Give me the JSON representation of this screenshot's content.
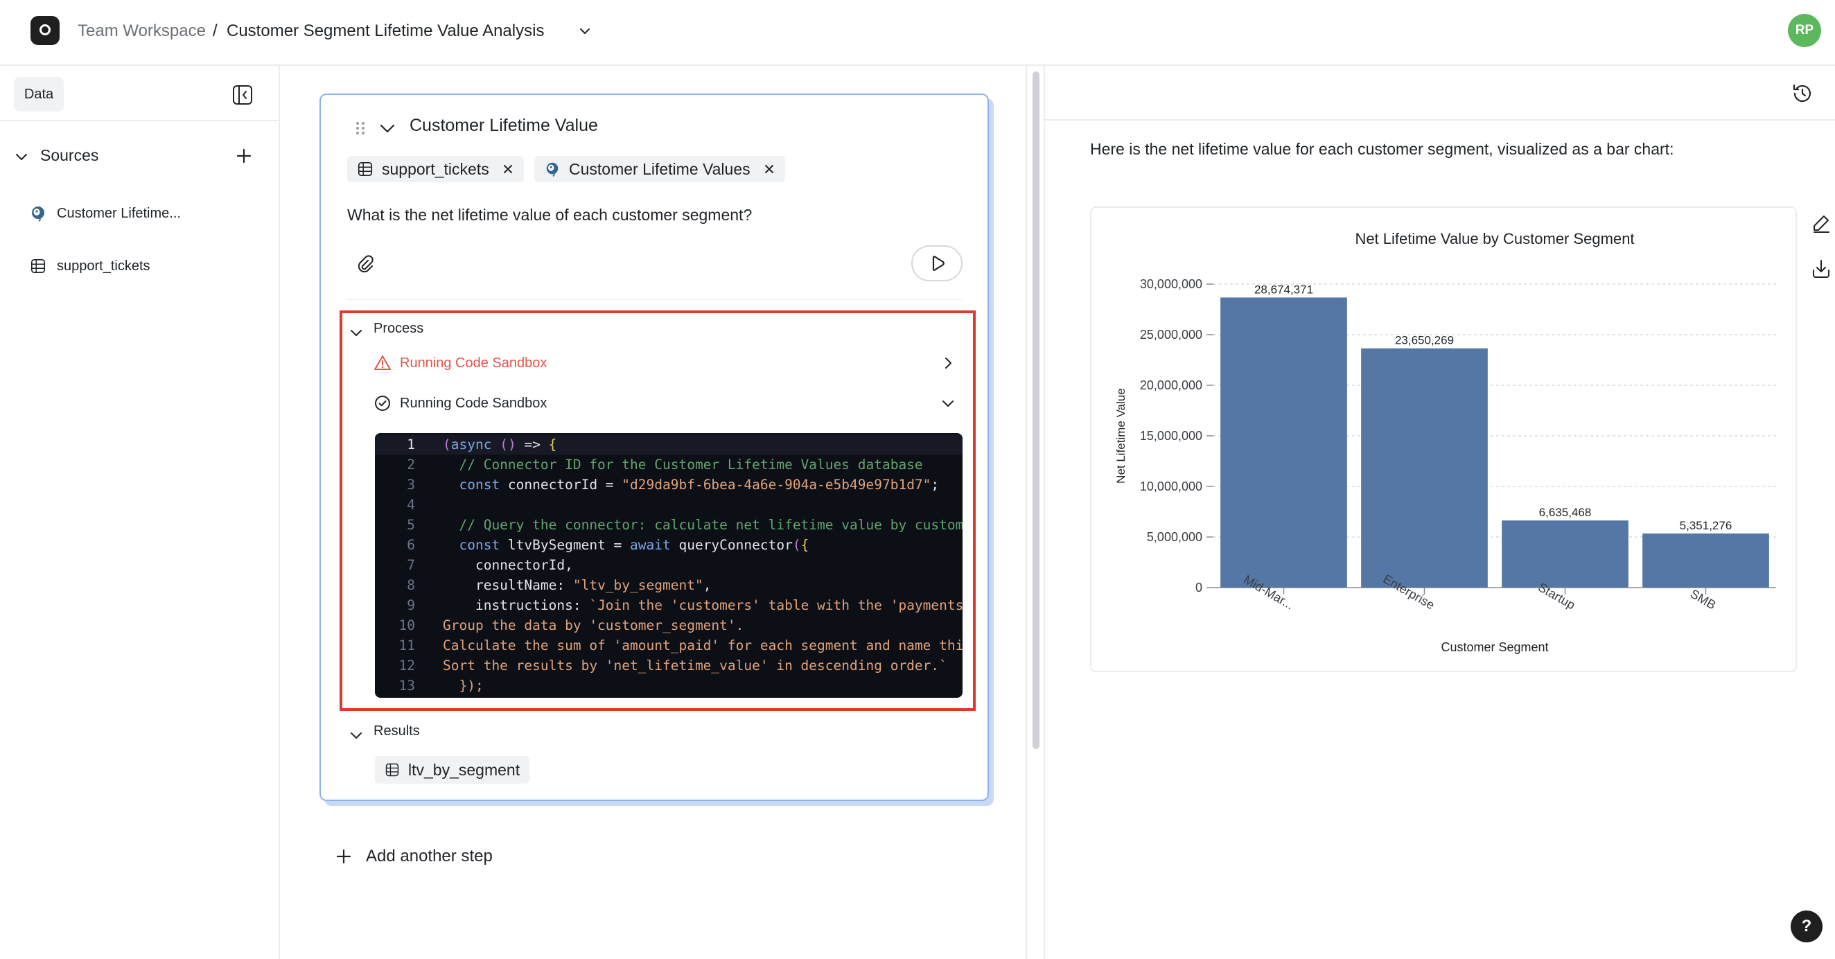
{
  "header": {
    "workspace": "Team Workspace",
    "separator": "/",
    "title": "Customer Segment Lifetime Value Analysis",
    "avatar_initials": "RP",
    "avatar_color": "#5cb85c"
  },
  "sidebar": {
    "tab_label": "Data",
    "sources_label": "Sources",
    "items": [
      {
        "label": "Customer Lifetime...",
        "icon": "postgres-elephant-icon"
      },
      {
        "label": "support_tickets",
        "icon": "table-icon"
      }
    ]
  },
  "step": {
    "title": "Customer Lifetime Value",
    "chips": [
      {
        "label": "support_tickets",
        "icon": "table-icon"
      },
      {
        "label": "Customer Lifetime Values",
        "icon": "postgres-elephant-icon"
      }
    ],
    "question": "What is the net lifetime value of each customer segment?",
    "process_label": "Process",
    "process_steps": [
      {
        "label": "Running Code Sandbox",
        "status": "error",
        "color": "#e5534b"
      },
      {
        "label": "Running Code Sandbox",
        "status": "success",
        "color": "#1f2328"
      }
    ],
    "code_lines": [
      {
        "n": "1",
        "text": "(async () => {"
      },
      {
        "n": "2",
        "text": "  // Connector ID for the Customer Lifetime Values database"
      },
      {
        "n": "3",
        "text": "  const connectorId = \"d29da9bf-6bea-4a6e-904a-e5b49e97b1d7\";"
      },
      {
        "n": "4",
        "text": ""
      },
      {
        "n": "5",
        "text": "  // Query the connector: calculate net lifetime value by custome"
      },
      {
        "n": "6",
        "text": "  const ltvBySegment = await queryConnector({"
      },
      {
        "n": "7",
        "text": "    connectorId,"
      },
      {
        "n": "8",
        "text": "    resultName: \"ltv_by_segment\","
      },
      {
        "n": "9",
        "text": "    instructions: `Join the 'customers' table with the 'payments'"
      },
      {
        "n": "10",
        "text": "Group the data by 'customer_segment'."
      },
      {
        "n": "11",
        "text": "Calculate the sum of 'amount_paid' for each segment and name this"
      },
      {
        "n": "12",
        "text": "Sort the results by 'net_lifetime_value' in descending order.`"
      },
      {
        "n": "13",
        "text": "  });"
      }
    ],
    "results_label": "Results",
    "result_chip": "ltv_by_segment",
    "add_step_label": "Add another step"
  },
  "answer": {
    "text": "Here is the net lifetime value for each customer segment, visualized as a bar chart:"
  },
  "colors": {
    "bar": "#5577a5",
    "highlight_border": "#e0392b",
    "card_border": "#8fb1ea",
    "error": "#e5534b"
  },
  "chart_data": {
    "type": "bar",
    "title": "Net Lifetime Value by Customer Segment",
    "xlabel": "Customer Segment",
    "ylabel": "Net Lifetime Value",
    "categories": [
      "Mid-Mar...",
      "Enterprise",
      "Startup",
      "SMB"
    ],
    "values": [
      28674371,
      23650269,
      6635468,
      5351276
    ],
    "value_labels": [
      "28,674,371",
      "23,650,269",
      "6,635,468",
      "5,351,276"
    ],
    "ylim": [
      0,
      30000000
    ],
    "yticks": [
      0,
      5000000,
      10000000,
      15000000,
      20000000,
      25000000,
      30000000
    ],
    "ytick_labels": [
      "0",
      "5,000,000",
      "10,000,000",
      "15,000,000",
      "20,000,000",
      "25,000,000",
      "30,000,000"
    ],
    "grid": true
  }
}
